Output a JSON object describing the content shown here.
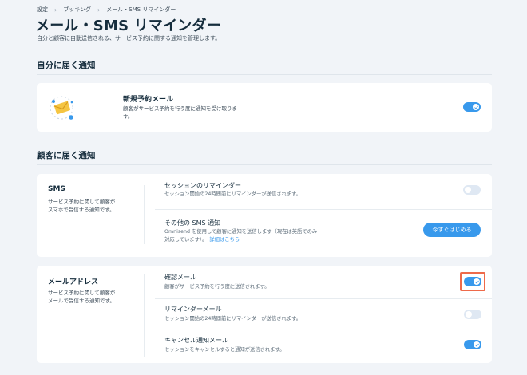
{
  "breadcrumb": [
    "設定",
    "ブッキング",
    "メール・SMS リマインダー"
  ],
  "page": {
    "title": "メール・SMS リマインダー",
    "subtitle": "自分と顧客に自動送信される、サービス予約に関する通知を管理します。"
  },
  "self_section": {
    "title": "自分に届く通知",
    "item_title": "新規予約メール",
    "item_desc_line1": "顧客がサービス予約を行う度に通知を受け取りま",
    "item_desc_line2": "す。",
    "toggle": "on"
  },
  "customer_section": {
    "title": "顧客に届く通知",
    "sms": {
      "title": "SMS",
      "desc_line1": "サービス予約に関して顧客が",
      "desc_line2": "スマホで受信する通知です。",
      "rows": [
        {
          "label": "セッションのリマインダー",
          "desc": "セッション開始の24時間前にリマインダーが送信されます。",
          "toggle": "off"
        },
        {
          "label": "その他の SMS 通知",
          "desc_line1": "Omnisend を使用して顧客に通知を送信します（現在は英語でのみ",
          "desc_line2": "対応しています）。",
          "link": "詳細はこちら",
          "button": "今すぐはじめる"
        }
      ]
    },
    "email": {
      "title": "メールアドレス",
      "desc_line1": "サービス予約に関して顧客が",
      "desc_line2": "メールで受信する通知です。",
      "rows": [
        {
          "label": "確認メール",
          "desc": "顧客がサービス予約を行う度に送信されます。",
          "toggle": "on"
        },
        {
          "label": "リマインダーメール",
          "desc": "セッション開始の24時間前にリマインダーが送信されます。",
          "toggle": "off"
        },
        {
          "label": "キャンセル通知メール",
          "desc": "セッションをキャンセルすると通知が送信されます。",
          "toggle": "on"
        }
      ]
    }
  },
  "colors": {
    "accent": "#3899ec",
    "highlight": "#ee6a4a",
    "envelope": "#f5c542"
  },
  "icons": {
    "chevron": "chevron-right-icon",
    "check": "check-icon",
    "envelope": "envelope-icon"
  }
}
